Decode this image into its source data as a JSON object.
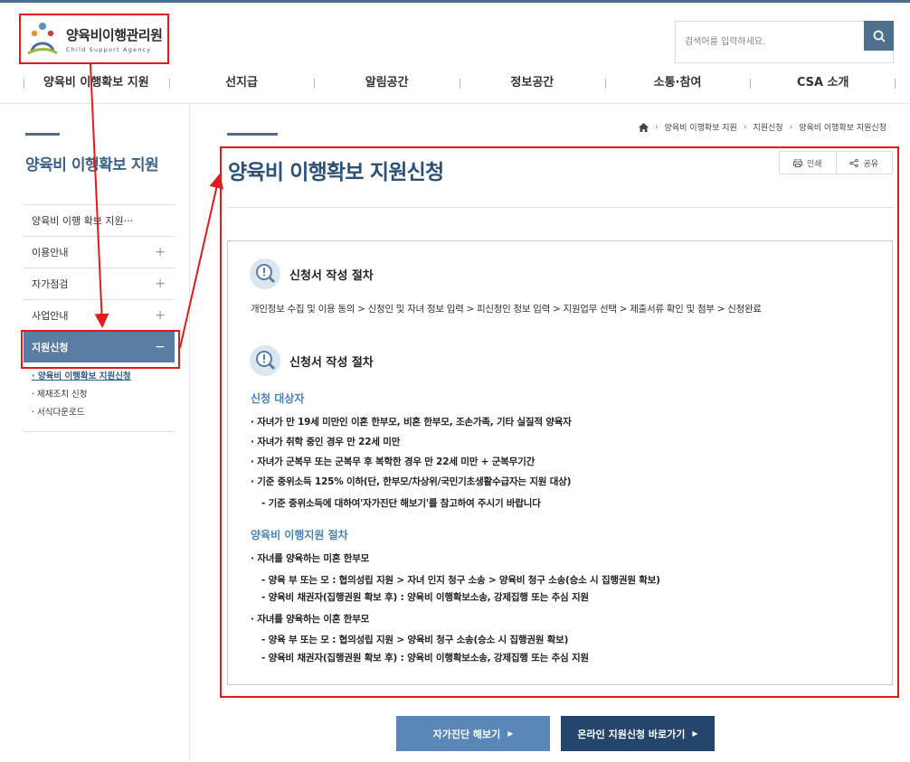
{
  "header": {
    "logo_ko": "양육비이행관리원",
    "logo_en": "Child Support Agency",
    "search_placeholder": "검색어를 입력하세요."
  },
  "gnb": [
    "양육비 이행확보 지원",
    "선지급",
    "알림공간",
    "정보공간",
    "소통·참여",
    "CSA 소개"
  ],
  "lnb": {
    "title": "양육비 이행확보 지원",
    "items": [
      {
        "label": "양육비 이행 확보 지원···"
      },
      {
        "label": "이용안내",
        "icon": "+"
      },
      {
        "label": "자가점검",
        "icon": "+"
      },
      {
        "label": "사업안내",
        "icon": "+"
      },
      {
        "label": "지원신청",
        "icon": "−"
      }
    ],
    "sub": [
      "· 양육비 이행확보 지원신청",
      "· 제재조치 신청",
      "· 서식다운로드"
    ]
  },
  "breadcrumb": [
    "양육비 이행확보 지원",
    "지원신청",
    "양육비 이행확보 지원신청"
  ],
  "page_title": "양육비 이행확보 지원신청",
  "tools": {
    "print": "인쇄",
    "share": "공유"
  },
  "section1": {
    "title": "신청서 작성 절차",
    "process": "개인정보 수집 및 이용 동의 > 신청인 및 자녀 정보 입력 > 피신청인 정보 입력 > 지원업무 선택 > 제출서류 확인 및 첨부 > 신청완료"
  },
  "section2": {
    "title": "신청서 작성 절차",
    "target_title": "신청 대상자",
    "target_lines": [
      "· 자녀가 만 19세 미만인 이혼 한부모, 비혼 한부모, 조손가족, 기타 실질적 양육자",
      "· 자녀가 취학 중인 경우 만 22세 미만",
      "· 자녀가 군복무 또는 군복무 후 복학한 경우 만 22세 미만 + 군복무기간",
      "· 기준 중위소득 125% 이하(단, 한부모/차상위/국민기초생활수급자는 지원 대상)",
      "- 기준 중위소득에 대하여'자가진단 해보기'를 참고하여 주시기 바랍니다"
    ],
    "proc_title": "양육비 이행지원 절차",
    "proc_lines": [
      "· 자녀를 양육하는 미혼 한부모",
      "- 양육 부 또는 모 : 협의성립 지원 > 자녀 인지 청구 소송 > 양육비 청구 소송(승소 시 집행권원 확보)",
      "- 양육비 채권자(집행권원 확보 후) : 양육비 이행확보소송, 강제집행 또는 추심 지원",
      "· 자녀를 양육하는 이혼 한부모",
      "- 양육 부 또는 모 : 협의성립 지원 > 양육비 청구 소송(승소 시 집행권원 확보)",
      "- 양육비 채권자(집행권원 확보 후) : 양육비 이행확보소송, 강제집행 또는 추심 지원"
    ]
  },
  "buttons": {
    "self_check": "자가진단 해보기",
    "online_apply": "온라인 지원신청 바로가기"
  },
  "colors": {
    "accent": "#4b6f92",
    "title": "#2e5178",
    "annotation": "#e01b1b"
  }
}
